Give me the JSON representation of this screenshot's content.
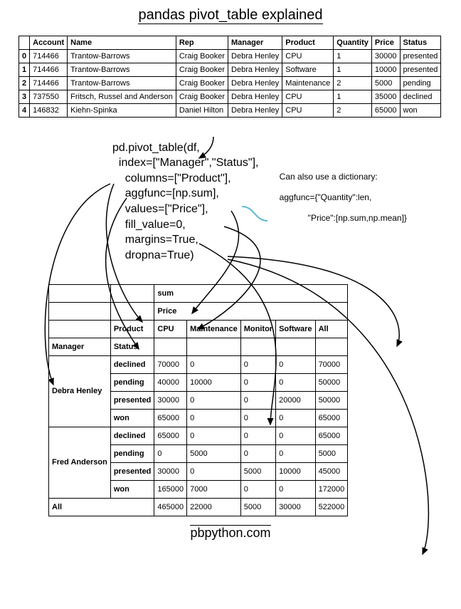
{
  "title": "pandas pivot_table explained",
  "source_table": {
    "columns": [
      "",
      "Account",
      "Name",
      "Rep",
      "Manager",
      "Product",
      "Quantity",
      "Price",
      "Status"
    ],
    "rows": [
      [
        "0",
        "714466",
        "Trantow-Barrows",
        "Craig Booker",
        "Debra Henley",
        "CPU",
        "1",
        "30000",
        "presented"
      ],
      [
        "1",
        "714466",
        "Trantow-Barrows",
        "Craig Booker",
        "Debra Henley",
        "Software",
        "1",
        "10000",
        "presented"
      ],
      [
        "2",
        "714466",
        "Trantow-Barrows",
        "Craig Booker",
        "Debra Henley",
        "Maintenance",
        "2",
        "5000",
        "pending"
      ],
      [
        "3",
        "737550",
        "Fritsch, Russel and Anderson",
        "Craig Booker",
        "Debra Henley",
        "CPU",
        "1",
        "35000",
        "declined"
      ],
      [
        "4",
        "146832",
        "Kiehn-Spinka",
        "Daniel Hilton",
        "Debra Henley",
        "CPU",
        "2",
        "65000",
        "won"
      ]
    ]
  },
  "code": {
    "l1": "pd.pivot_table(df,",
    "l2": "  index=[\"Manager\",\"Status\"],",
    "l3": "    columns=[\"Product\"],",
    "l4": "    aggfunc=[np.sum],",
    "l5": "    values=[\"Price\"],",
    "l6": "    fill_value=0,",
    "l7": "    margins=True,",
    "l8": "    dropna=True)"
  },
  "annotation": {
    "l1": "Can also use a dictionary:",
    "l2": "aggfunc={\"Quantity\":len,",
    "l3": "            \"Price\":[np.sum,np.mean]}"
  },
  "pivot": {
    "hdr_aggfunc": "sum",
    "hdr_values": "Price",
    "hdr_columns_label": "Product",
    "columns": [
      "CPU",
      "Maintenance",
      "Monitor",
      "Software",
      "All"
    ],
    "index_labels": [
      "Manager",
      "Status"
    ],
    "groups": [
      {
        "manager": "Debra Henley",
        "rows": [
          {
            "status": "declined",
            "vals": [
              "70000",
              "0",
              "0",
              "0",
              "70000"
            ]
          },
          {
            "status": "pending",
            "vals": [
              "40000",
              "10000",
              "0",
              "0",
              "50000"
            ]
          },
          {
            "status": "presented",
            "vals": [
              "30000",
              "0",
              "0",
              "20000",
              "50000"
            ]
          },
          {
            "status": "won",
            "vals": [
              "65000",
              "0",
              "0",
              "0",
              "65000"
            ]
          }
        ]
      },
      {
        "manager": "Fred Anderson",
        "rows": [
          {
            "status": "declined",
            "vals": [
              "65000",
              "0",
              "0",
              "0",
              "65000"
            ]
          },
          {
            "status": "pending",
            "vals": [
              "0",
              "5000",
              "0",
              "0",
              "5000"
            ]
          },
          {
            "status": "presented",
            "vals": [
              "30000",
              "0",
              "5000",
              "10000",
              "45000"
            ]
          },
          {
            "status": "won",
            "vals": [
              "165000",
              "7000",
              "0",
              "0",
              "172000"
            ]
          }
        ]
      }
    ],
    "totals_label": "All",
    "totals": [
      "465000",
      "22000",
      "5000",
      "30000",
      "522000"
    ]
  },
  "footer": "pbpython.com"
}
